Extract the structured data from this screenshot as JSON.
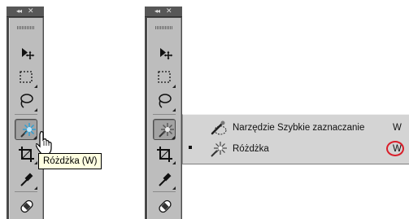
{
  "panel": {
    "collapse_glyph": "◂◂",
    "close_glyph": "✕",
    "tools": [
      "move-tool",
      "rectangular-marquee-tool",
      "lasso-tool",
      "magic-wand-tool",
      "crop-tool",
      "eyedropper-tool",
      "spot-healing-brush-tool"
    ]
  },
  "tooltip": {
    "text": "Różdżka (W)"
  },
  "flyout": {
    "items": [
      {
        "label": "Narzędzie Szybkie zaznaczanie",
        "shortcut": "W",
        "icon": "quick-selection-icon",
        "selected": false
      },
      {
        "label": "Różdżka",
        "shortcut": "W",
        "icon": "magic-wand-icon",
        "selected": true
      }
    ],
    "highlight_color": "#d91e2a"
  },
  "colors": {
    "panel_dark": "#4a4a4a",
    "toolbar_gray": "#bdbdbd",
    "tooltip_bg": "#ffffe1"
  }
}
